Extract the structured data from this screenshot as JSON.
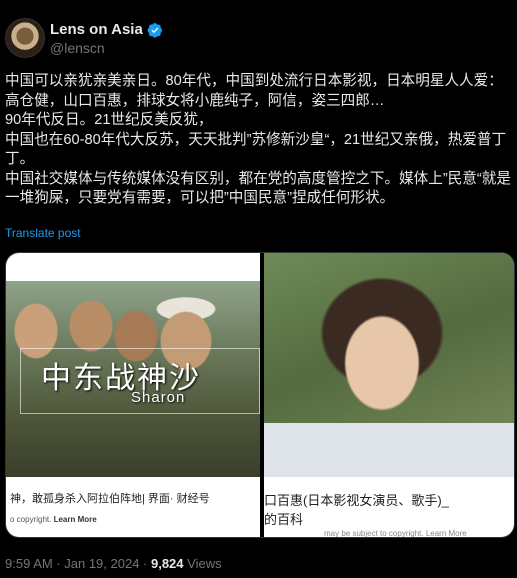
{
  "author": {
    "display_name": "Lens on Asia",
    "handle": "@lenscn",
    "verified_icon": "verified-badge-icon",
    "avatar_icon": "avatar-camera-lens"
  },
  "tweet": {
    "paragraphs": [
      "中国可以亲犹亲美亲日。80年代，中国到处流行日本影视，日本明星人人爱：高仓健，山口百惠，排球女将小鹿纯子，阿信，姿三四郎…",
      "90年代反日。21世纪反美反犹，",
      "中国也在60-80年代大反苏，天天批判”苏修新沙皇“，21世纪又亲俄，热爱普丁丁。",
      "中国社交媒体与传统媒体没有区别，都在党的高度管控之下。媒体上”民意“就是一堆狗屎，只要党有需要，可以把”中国民意”捏成任何形状。"
    ],
    "translate_label": "Translate post"
  },
  "media": {
    "left": {
      "overlay_cn": "中东战神沙",
      "overlay_en": "Sharon",
      "caption": "神，敢孤身杀入阿拉伯阵地| 界面· 财经号",
      "copyright": "o copyright.",
      "learn_more": "Learn More"
    },
    "right": {
      "caption_line1": "口百惠(日本影视女演员、歌手)_",
      "caption_line2": "的百科",
      "copyright": "may be subject to copyright. Learn More"
    }
  },
  "meta": {
    "time": "9:59 AM · Jan 19, 2024 · ",
    "views_count": "9,824",
    "views_label": " Views"
  },
  "colors": {
    "background": "#000000",
    "text": "#e7e9ea",
    "muted": "#71767b",
    "link": "#1d9bf0"
  }
}
